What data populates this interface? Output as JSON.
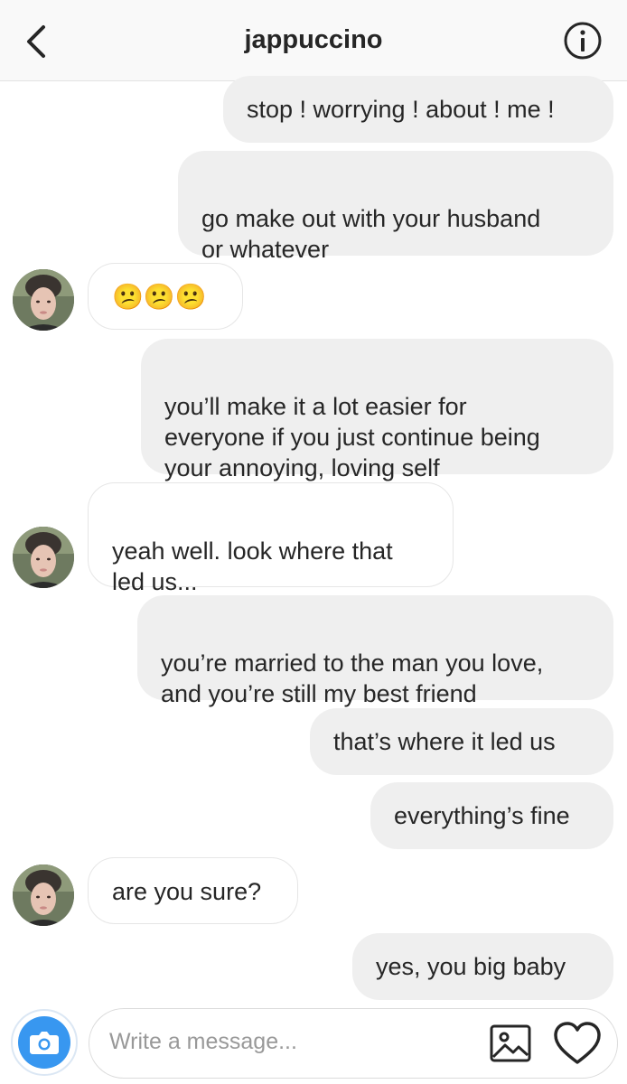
{
  "header": {
    "title": "jappuccino",
    "back_icon": "chevron-left-icon",
    "info_icon": "info-icon"
  },
  "messages": [
    {
      "side": "sent",
      "text": "stop ! worrying ! about ! me !"
    },
    {
      "side": "sent",
      "text": "go make out with your husband\nor whatever"
    },
    {
      "side": "received",
      "text": "😕😕😕"
    },
    {
      "side": "sent",
      "text": "you’ll make it a lot easier for\neveryone if you just continue being\nyour annoying, loving self"
    },
    {
      "side": "received",
      "text": "yeah well. look where that\nled us..."
    },
    {
      "side": "sent",
      "text": "you’re married to the man you love,\nand you’re still my best friend"
    },
    {
      "side": "sent",
      "text": "that’s where it led us"
    },
    {
      "side": "sent",
      "text": "everything’s fine"
    },
    {
      "side": "received",
      "text": "are you sure?"
    },
    {
      "side": "sent",
      "text": "yes, you big baby"
    }
  ],
  "composer": {
    "placeholder": "Write a message...",
    "camera_icon": "camera-icon",
    "gallery_icon": "image-icon",
    "like_icon": "heart-icon"
  },
  "colors": {
    "sent_bubble": "#efefef",
    "received_border": "#e6e6e6",
    "accent": "#3897f0",
    "text": "#262626",
    "placeholder": "#999999"
  }
}
